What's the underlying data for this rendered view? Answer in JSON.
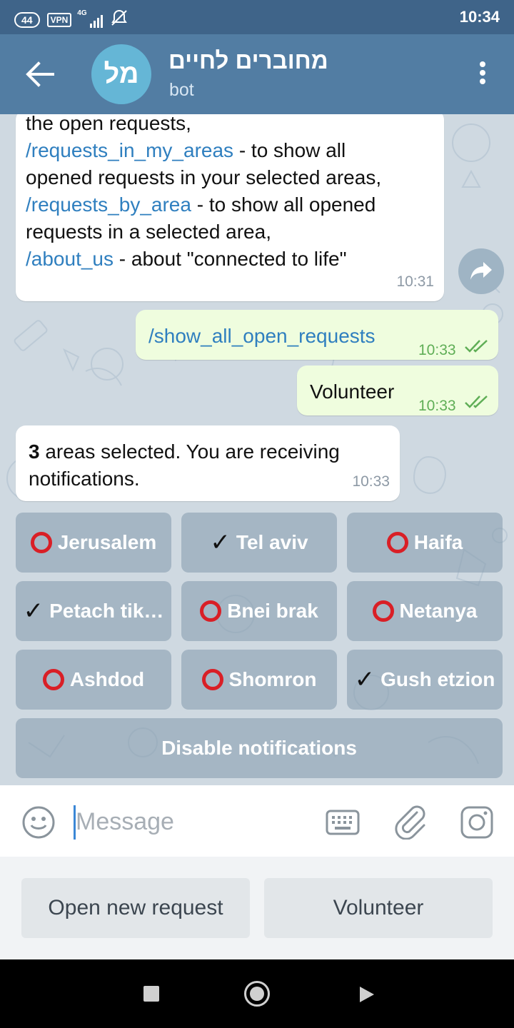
{
  "status_bar": {
    "notification_count": "44",
    "vpn_label": "VPN",
    "network": "4G",
    "time": "10:34"
  },
  "header": {
    "avatar_initials": "מל",
    "title": "מחוברים לחיים",
    "subtitle": "bot",
    "accent_color": "#527da3"
  },
  "messages": {
    "bot_commands": {
      "lines": [
        {
          "link": "",
          "text": "the open requests,"
        },
        {
          "link": "/requests_in_my_areas",
          "text": " - to show all"
        },
        {
          "link": "",
          "text": "opened requests in your selected areas,"
        },
        {
          "link": "/requests_by_area",
          "text": " - to show all opened"
        },
        {
          "link": "",
          "text": "requests in a selected area,"
        },
        {
          "link": "/about_us",
          "text": " - about \"connected to life\""
        }
      ],
      "time": "10:31"
    },
    "user_command": {
      "text": "/show_all_open_requests",
      "time": "10:33"
    },
    "user_volunteer": {
      "text": "Volunteer",
      "time": "10:33"
    },
    "bot_status": {
      "count": "3",
      "line1": " areas selected. You are receiving",
      "line2": "notifications.",
      "time": "10:33"
    }
  },
  "inline_keyboard": {
    "areas": [
      {
        "label": "Jerusalem",
        "selected": false
      },
      {
        "label": "Tel aviv",
        "selected": true
      },
      {
        "label": "Haifa",
        "selected": false
      },
      {
        "label": "Petach tik…",
        "selected": true
      },
      {
        "label": "Bnei brak",
        "selected": false
      },
      {
        "label": "Netanya",
        "selected": false
      },
      {
        "label": "Ashdod",
        "selected": false
      },
      {
        "label": "Shomron",
        "selected": false
      },
      {
        "label": "Gush etzion",
        "selected": true
      }
    ],
    "check_glyph": "✓",
    "disable_label": "Disable notifications"
  },
  "input": {
    "placeholder": "Message"
  },
  "reply_keyboard": {
    "open_request": "Open new request",
    "volunteer": "Volunteer"
  }
}
